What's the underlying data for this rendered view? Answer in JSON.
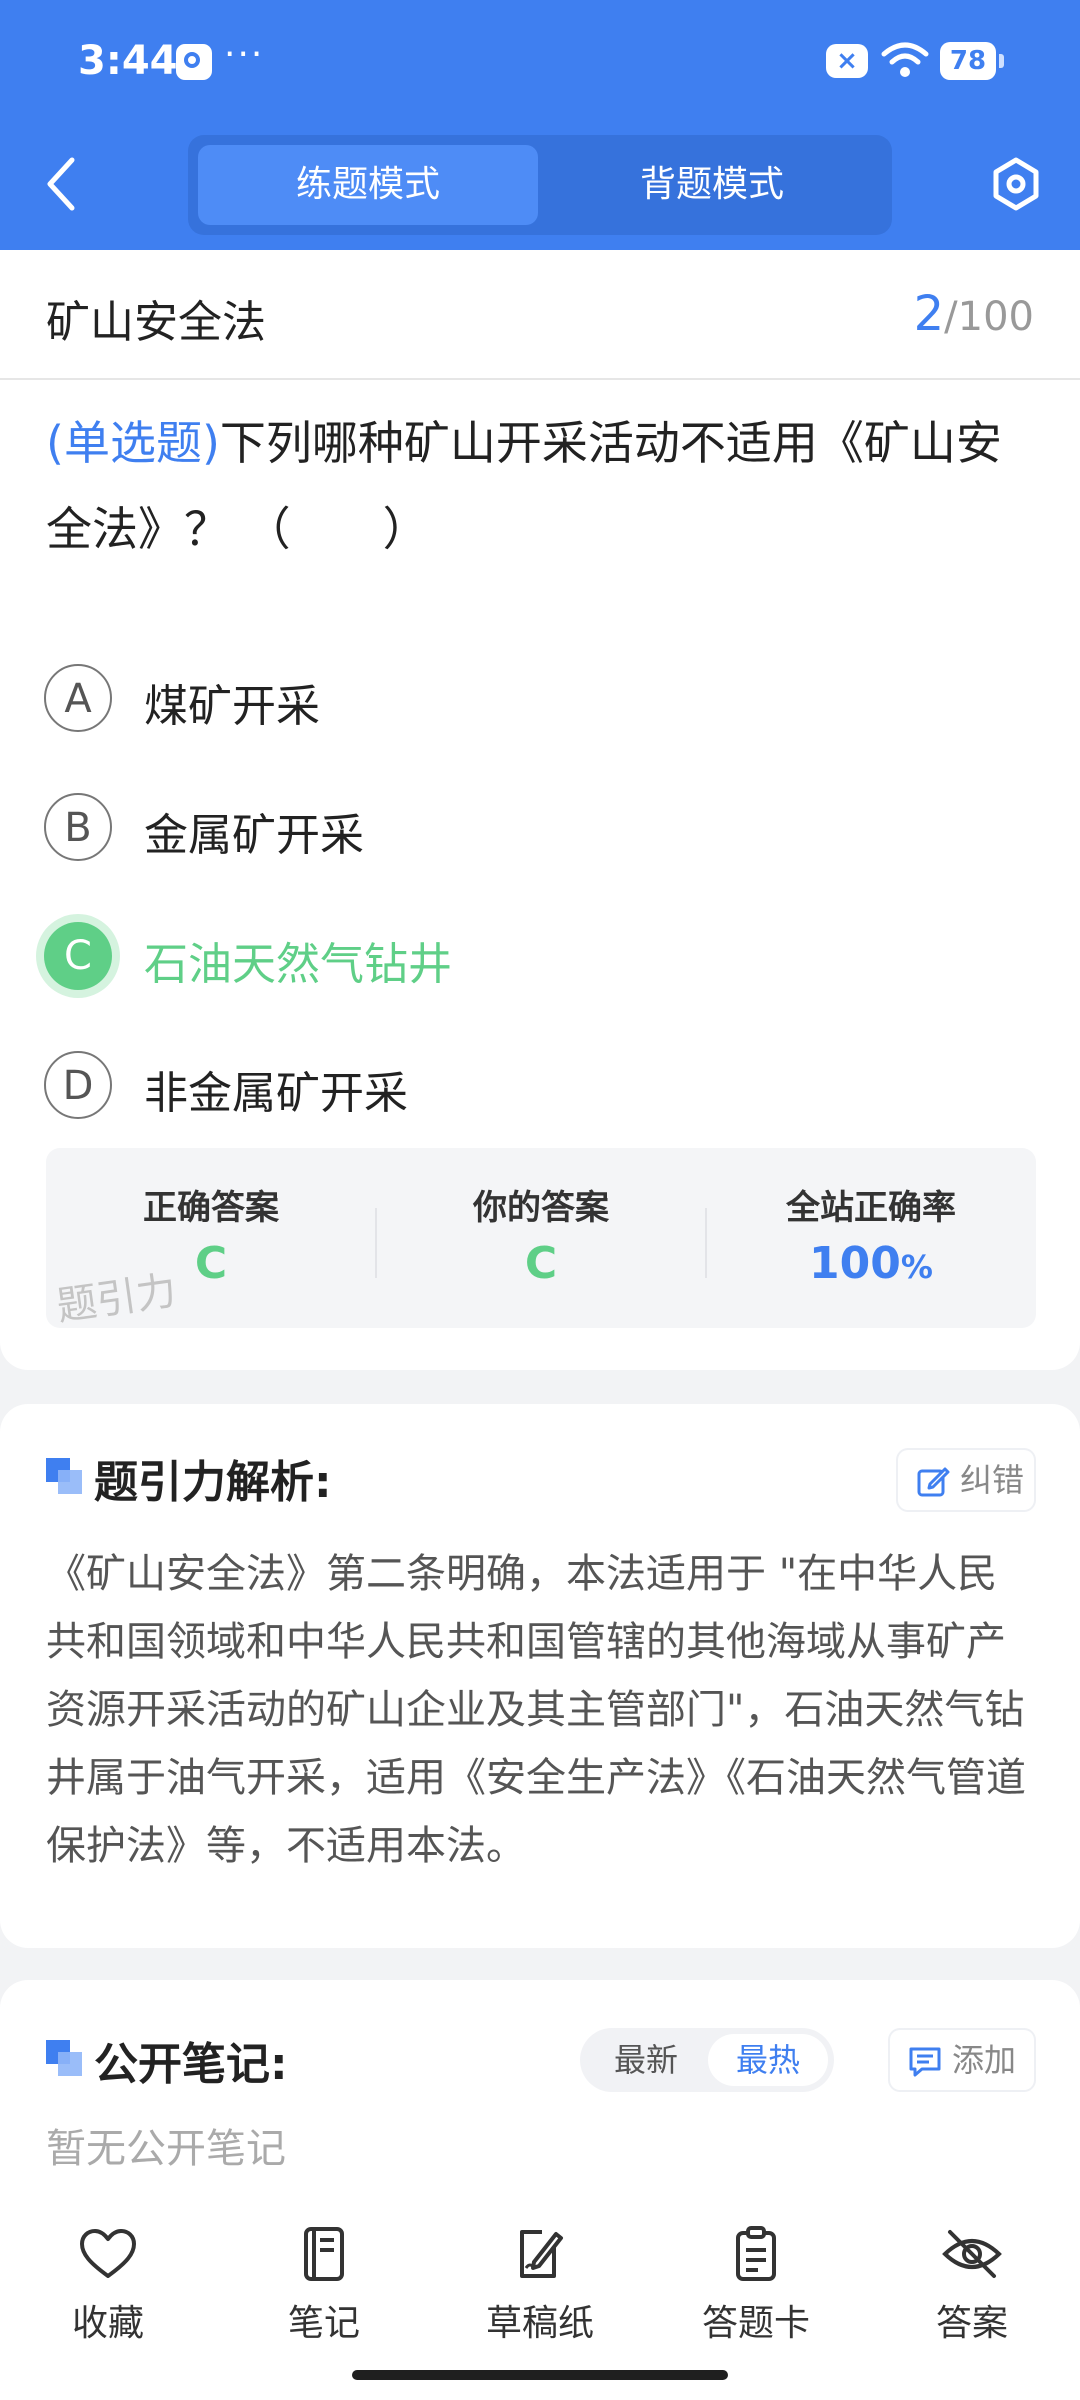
{
  "status_bar": {
    "time": "3:44",
    "dots": "···",
    "battery": "78"
  },
  "header": {
    "tabs": [
      {
        "label": "练题模式"
      },
      {
        "label": "背题模式"
      }
    ]
  },
  "question": {
    "subject": "矿山安全法",
    "progress_current": "2",
    "progress_total": "/100",
    "type_label": "(单选题)",
    "text": "下列哪种矿山开采活动不适用《矿山安全法》？ （　　）",
    "options": [
      {
        "letter": "A",
        "text": "煤矿开采"
      },
      {
        "letter": "B",
        "text": "金属矿开采"
      },
      {
        "letter": "C",
        "text": "石油天然气钻井"
      },
      {
        "letter": "D",
        "text": "非金属矿开采"
      }
    ],
    "selected": "C",
    "stats": {
      "correct_label": "正确答案",
      "correct_value": "C",
      "yours_label": "你的答案",
      "yours_value": "C",
      "rate_label": "全站正确率",
      "rate_value": "100",
      "rate_unit": "%"
    },
    "watermark": "题引力"
  },
  "analysis": {
    "title": "题引力解析:",
    "report_label": "纠错",
    "text": "《矿山安全法》第二条明确，本法适用于 \"在中华人民共和国领域和中华人民共和国管辖的其他海域从事矿产资源开采活动的矿山企业及其主管部门\"，石油天然气钻井属于油气开采，适用《安全生产法》《石油天然气管道保护法》等，不适用本法。"
  },
  "notes": {
    "title": "公开笔记:",
    "sort_options": [
      "最新",
      "最热"
    ],
    "active_sort": "最热",
    "add_label": "添加",
    "empty_text": "暂无公开笔记"
  },
  "bottom_nav": [
    {
      "label": "收藏",
      "icon": "heart-icon"
    },
    {
      "label": "笔记",
      "icon": "notebook-icon"
    },
    {
      "label": "草稿纸",
      "icon": "draft-paper-icon"
    },
    {
      "label": "答题卡",
      "icon": "answer-sheet-icon"
    },
    {
      "label": "答案",
      "icon": "eye-off-icon"
    }
  ],
  "colors": {
    "primary": "#3f7ff0",
    "correct": "#5fcf87"
  }
}
